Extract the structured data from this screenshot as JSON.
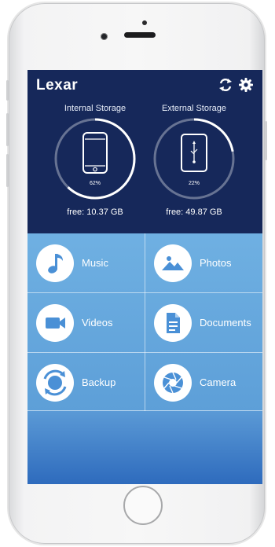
{
  "app": {
    "logo_text": "Lexar"
  },
  "header": {
    "sync_icon": "sync-icon",
    "settings_icon": "gear-icon"
  },
  "storage": {
    "internal": {
      "label": "Internal Storage",
      "percent_text": "62%",
      "percent": 62,
      "free_text": "free: 10.37 GB",
      "icon": "phone-icon"
    },
    "external": {
      "label": "External Storage",
      "percent_text": "22%",
      "percent": 22,
      "free_text": "free: 49.87 GB",
      "icon": "usb-drive-icon"
    }
  },
  "tiles": [
    {
      "label": "Music",
      "icon": "music-note-icon"
    },
    {
      "label": "Photos",
      "icon": "photo-icon"
    },
    {
      "label": "Videos",
      "icon": "video-camera-icon"
    },
    {
      "label": "Documents",
      "icon": "document-icon"
    },
    {
      "label": "Backup",
      "icon": "backup-icon"
    },
    {
      "label": "Camera",
      "icon": "camera-aperture-icon"
    }
  ],
  "colors": {
    "header_bg": "#16285a",
    "tile_bg": "#6fb0e2",
    "accent_white": "#ffffff"
  }
}
